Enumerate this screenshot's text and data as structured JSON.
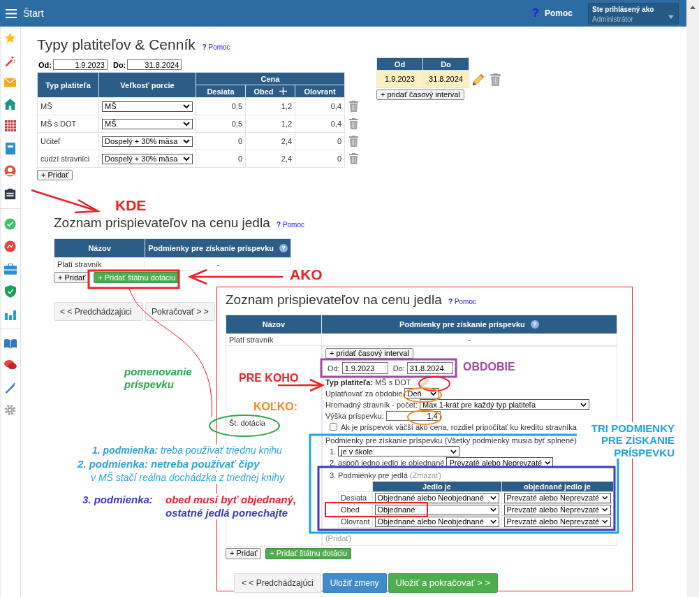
{
  "top_bar": {
    "title": "Štart",
    "help_mark": "?",
    "help": "Pomoc",
    "user_label": "Ste prihlásený ako",
    "user_value": "Administrátor"
  },
  "price_list": {
    "title": "Typy platiteľov & Cenník",
    "help_mark": "?",
    "help": "Pomoc",
    "from_label": "Od:",
    "from_value": "1.9.2023",
    "to_label": "Do:",
    "to_value": "31.8.2024",
    "columns": {
      "payer": "Typ platiteľa",
      "portion": "Veľkosť porcie",
      "price": "Cena",
      "meals": [
        "Desiata",
        "Obed",
        "Olovrant"
      ]
    },
    "rows": [
      {
        "payer": "MŠ",
        "portion": "MŠ",
        "prices": [
          "0,5",
          "1,2",
          "0,4"
        ]
      },
      {
        "payer": "MŠ s DOT",
        "portion": "MŠ",
        "prices": [
          "0,5",
          "1,2",
          "0,4"
        ]
      },
      {
        "payer": "Učiteľ",
        "portion": "Dospelý + 30% mäsa",
        "prices": [
          "0",
          "2,4",
          "0"
        ]
      },
      {
        "payer": "cudzí stravníci",
        "portion": "Dospelý + 30% mäsa",
        "prices": [
          "0",
          "2,4",
          "0"
        ]
      }
    ],
    "add_button": "+ Pridať"
  },
  "intervals": {
    "columns": [
      "Od",
      "Do"
    ],
    "rows": [
      {
        "from": "1.9.2023",
        "to": "31.8.2024",
        "selected": true
      }
    ],
    "add_button": "+ pridať časový interval"
  },
  "contributors": {
    "title": "Zoznam prispievateľov na cenu jedla",
    "help_mark": "?",
    "help": "Pomoc",
    "columns": [
      "Názov",
      "Podmienky pre získanie príspevku"
    ],
    "info_mark": "?",
    "rows": [
      {
        "name": "Platí stravník",
        "conditions": "-"
      }
    ],
    "add_button": "+ Pridať",
    "add_state_button": "+ Pridať štátnu dotáciu",
    "prev_button": "< < Predchádzajúci",
    "next_button": "Pokračovať > >"
  },
  "inset": {
    "title": "Zoznam prispievateľov na cenu jedla",
    "help_mark": "?",
    "help": "Pomoc",
    "columns": [
      "Názov",
      "Podmienky pre získanie príspevku"
    ],
    "info_mark": "?",
    "rows": [
      {
        "name": "Platí stravník",
        "conditions": "-"
      }
    ],
    "subsidy": {
      "name": "Št. dotácia",
      "add_interval_button": "+ pridať časový interval",
      "from_label": "Od:",
      "from_value": "1.9.2023",
      "to_label": "Do:",
      "to_value": "31.8.2024",
      "payer_label": "Typ platiteľa:",
      "payer_value": "MŠ s DOT",
      "period_label": "Uplatňovať za obdobie",
      "period_value": "Deň",
      "bulk_label": "Hromadný stravník - počet:",
      "bulk_value": "Max 1-krát pre každý typ platiteľa",
      "amount_label": "Výška príspevku:",
      "amount_value": "1,4",
      "credit_checkbox": {
        "label": "Ak je príspevok väčší ako cena, rozdiel pripočítať ku kreditu stravníka",
        "checked": false
      },
      "conditions_title": "Podmienky pre získanie príspevku (Všetky podmienky musia byť splnené):",
      "conditions": [
        {
          "kind": "select",
          "number": "1.",
          "value": "je v škole"
        },
        {
          "kind": "labeled_select",
          "number": "2.",
          "label": "aspoň jedno jedlo je objednané",
          "value": "Prevzaté alebo Neprevzaté"
        },
        {
          "kind": "meal_table",
          "number": "3.",
          "label": "Podmienky pre jedlá",
          "delete_link": "(Zmazať)",
          "columns": [
            "Jedlo je",
            "objednané jedlo je"
          ],
          "rows": [
            {
              "meal": "Desiata",
              "ordered": "Objednané alebo Neobjednané",
              "taken": "Prevzaté alebo Neprevzaté"
            },
            {
              "meal": "Obed",
              "ordered": "Objednané",
              "taken": "Prevzaté alebo Neprevzaté"
            },
            {
              "meal": "Olovrant",
              "ordered": "Objednané alebo Neobjednané",
              "taken": "Prevzaté alebo Neprevzaté"
            }
          ]
        }
      ],
      "add_condition": "(Pridať)"
    },
    "add_button": "+ Pridať",
    "add_state_button": "+ Pridať štátnu dotáciu",
    "prev_button": "< < Predchádzajúci",
    "save_button": "Uložiť zmeny",
    "save_next_button": "Uložiť a pokračovať > >"
  },
  "annotations": [
    {
      "text": "KDE",
      "color": "#ee2026"
    },
    {
      "text": "AKO",
      "color": "#ee2026"
    },
    {
      "text": "pomenovanie príspevku",
      "color": "#2aa84a"
    },
    {
      "text": "PRE KOHO",
      "color": "#ee2026"
    },
    {
      "text": "OBDOBIE",
      "color": "#a347a8"
    },
    {
      "text": "KOĽKO:",
      "color": "#f58a2a"
    },
    {
      "text": "**1. podmienka:** treba používať triednu knihu",
      "color": "#29a3e0"
    },
    {
      "text": "2. podmienka: netreba používať čipy",
      "color": "#29a3e0"
    },
    {
      "text": "TRI  PODMIENKY PRE ZÍSKANIE PRÍSPEVKU",
      "color": "#1ea3e6"
    },
    {
      "text": "v MŠ stačí reálna dochádzka z triednej knihy",
      "color": "#29a3e0"
    },
    {
      "text": "3. podmienka:",
      "color": "#3a3ac4"
    },
    {
      "text": "obed musí byť objednaný,",
      "color": "#ee2026"
    },
    {
      "text": "ostatné jedlá ponechajte",
      "color": "#3a3ac4"
    }
  ]
}
